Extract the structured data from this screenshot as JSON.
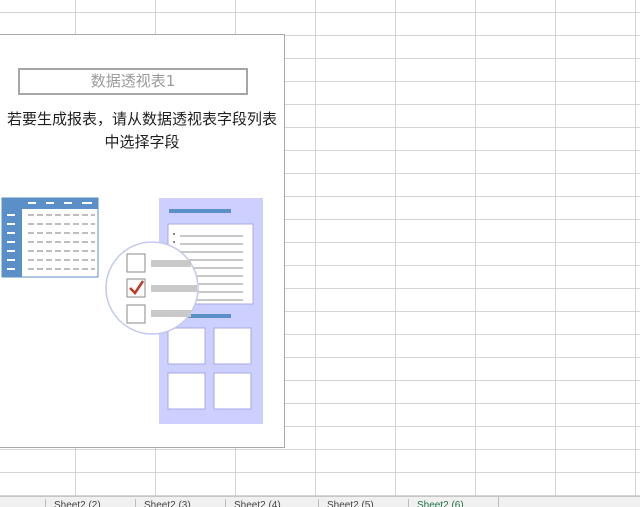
{
  "pivot": {
    "name": "数据透视表1",
    "hint": "若要生成报表，请从数据透视表字段列表\n中选择字段"
  },
  "sheet_tabs": [
    {
      "label": "Sheet2 (2)"
    },
    {
      "label": "Sheet2 (3)"
    },
    {
      "label": "Sheet2 (4)"
    },
    {
      "label": "Sheet2 (5)"
    },
    {
      "label": "Sheet2 (6)",
      "active": true
    }
  ],
  "colors": {
    "gridline": "#d4d4d4",
    "table_blue": "#5b8fc7",
    "field_list_bg": "#cdd0ff",
    "check_red": "#c0392b",
    "active_tab": "#217346"
  }
}
